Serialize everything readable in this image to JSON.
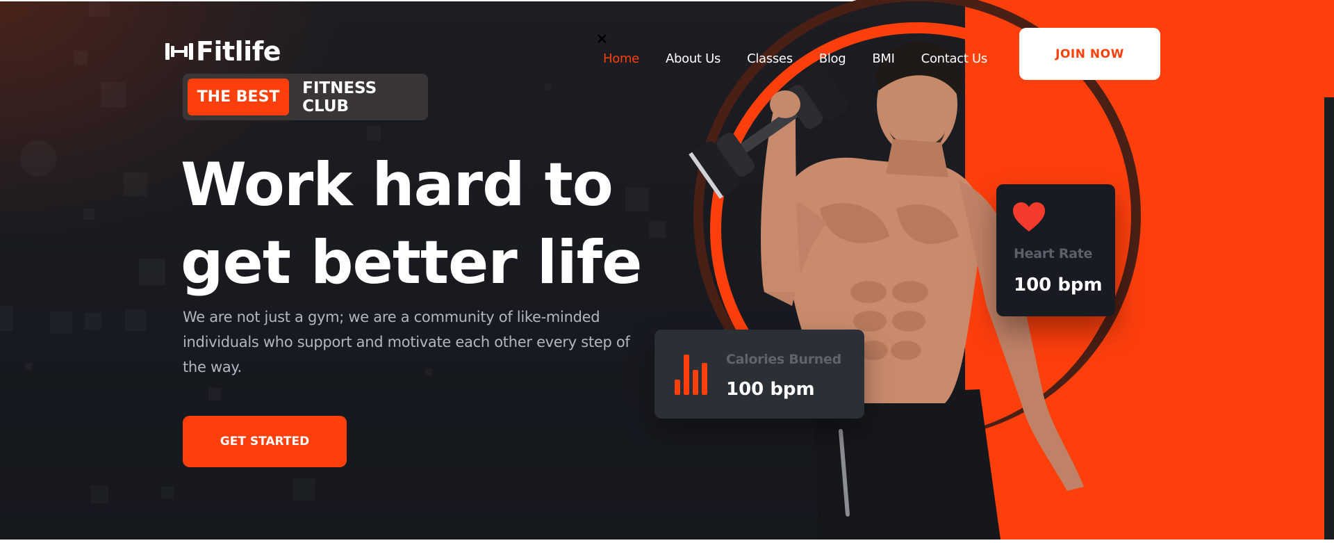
{
  "brand": {
    "name": "Fitlife",
    "logo_icon": "dumbbell-icon"
  },
  "nav": {
    "items": [
      {
        "label": "Home",
        "active": true
      },
      {
        "label": "About Us",
        "active": false
      },
      {
        "label": "Classes",
        "active": false
      },
      {
        "label": "Blog",
        "active": false
      },
      {
        "label": "BMI",
        "active": false
      },
      {
        "label": "Contact Us",
        "active": false
      }
    ],
    "join_label": "JOIN NOW"
  },
  "hero": {
    "badge_highlight": "THE BEST",
    "badge_rest": "FITNESS CLUB",
    "headline_line1": "Work hard to",
    "headline_line2": "get better life",
    "subtitle": "We are not just a gym; we are a community of like-minded individuals who support and motivate each other every step of the way.",
    "cta_label": "GET STARTED"
  },
  "stats": {
    "heart": {
      "label": "Heart Rate",
      "value": "100 bpm",
      "icon": "heart-icon"
    },
    "calories": {
      "label": "Calories Burned",
      "value": "100 bpm",
      "icon": "bar-chart-icon"
    }
  },
  "colors": {
    "accent": "#fd3f0c",
    "background": "#16191f",
    "card": "#181c22",
    "card_alt": "#2b2f36",
    "text_muted": "#b3b6bf"
  }
}
